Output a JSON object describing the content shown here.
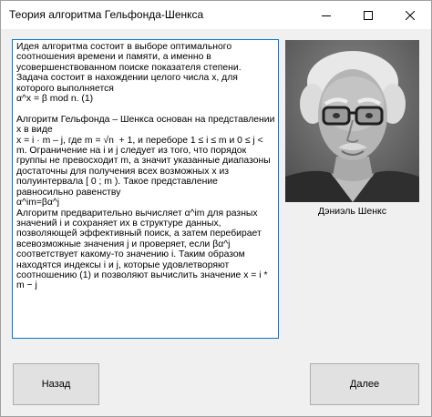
{
  "window": {
    "title": "Теория алгоритма Гельфонда-Шенкса",
    "controls": {
      "minimize": "minimize-icon",
      "maximize": "maximize-icon",
      "close": "close-icon"
    }
  },
  "content": {
    "text": "Идея алгоритма состоит в выборе оптимального соотношения времени и памяти, а именно в усовершенствованном поиске показателя степени. Задача состоит в нахождении целого числа x, для которого выполняется\nα^x = β mod n. (1)\n\nАлгоритм Гельфонда – Шенкса основан на представлении x в виде\nx = i · m – j, где m = √n  + 1, и переборе 1 ≤ i ≤ m и 0 ≤ j < m. Ограничение на i и j следует из того, что порядок группы не превосходит m, а значит указанные диапазоны достаточны для получения всех возможных x из полуинтервала [ 0 ; m ). Такое представление равносильно равенству\nα^im=βα^j\nАлгоритм предварительно вычисляет α^im для разных значений i и сохраняет их в структуре данных, позволяющей эффективный поиск, а затем перебирает всевозможные значения j и проверяет, если βα^j соответствует какому-то значению i. Таким образом находятся индексы i и j, которые удовлетворяют соотношению (1) и позволяют вычислить значение x = i * m − j"
  },
  "portrait": {
    "caption": "Дэниэль Шенкс"
  },
  "buttons": {
    "back": "Назад",
    "next": "Далее"
  }
}
